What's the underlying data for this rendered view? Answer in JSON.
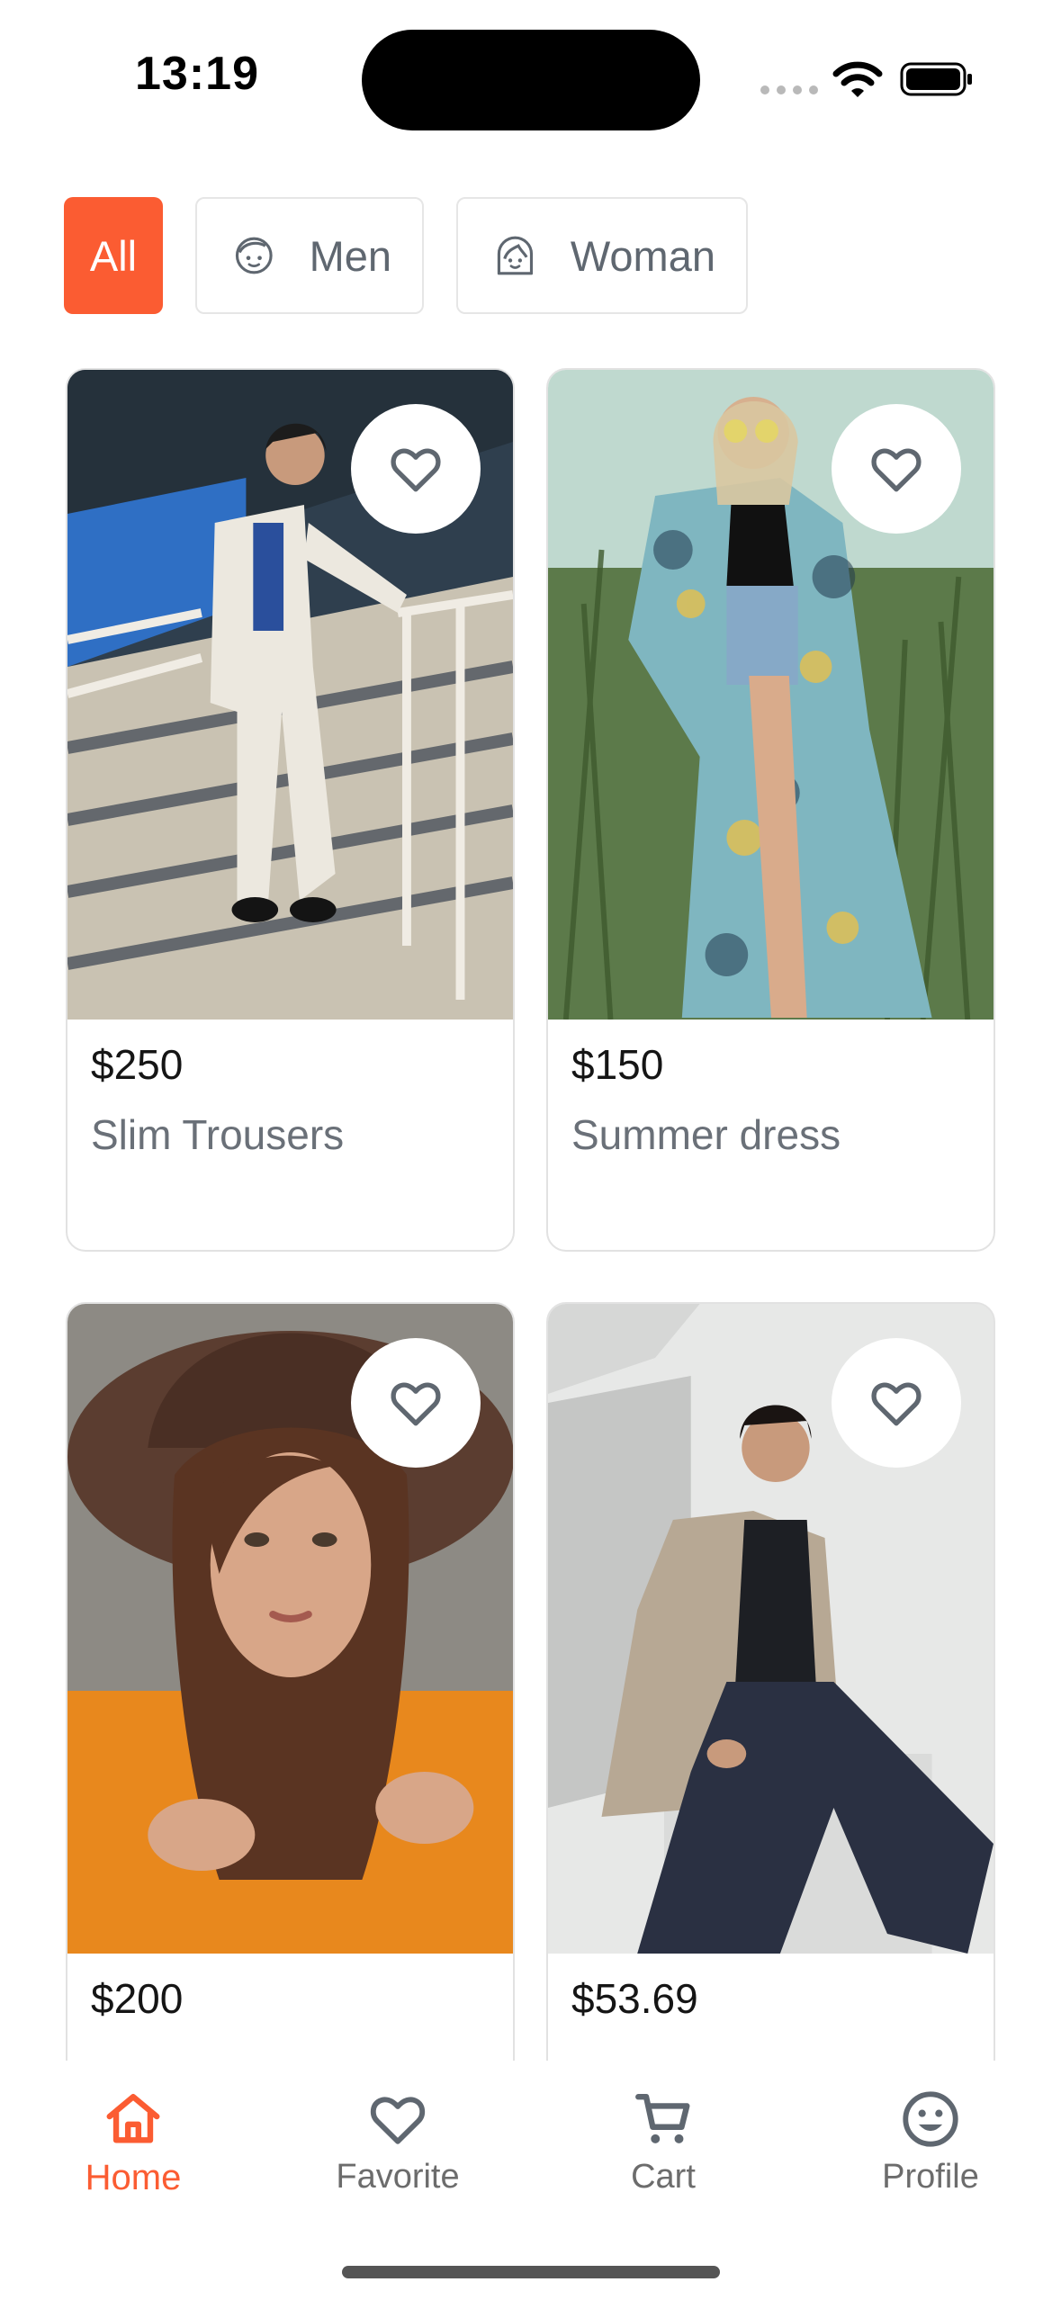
{
  "status": {
    "time": "13:19"
  },
  "filters": [
    {
      "label": "All",
      "icon": "none",
      "selected": true
    },
    {
      "label": "Men",
      "icon": "man-face-icon",
      "selected": false
    },
    {
      "label": "Woman",
      "icon": "woman-face-icon",
      "selected": false
    }
  ],
  "products": [
    {
      "price": "$250",
      "name": "Slim Trousers"
    },
    {
      "price": "$150",
      "name": "Summer dress"
    },
    {
      "price": "$200",
      "name": ""
    },
    {
      "price": "$53.69",
      "name": ""
    }
  ],
  "nav": {
    "home": "Home",
    "favorite": "Favorite",
    "cart": "Cart",
    "profile": "Profile"
  },
  "colors": {
    "accent": "#fb5c32",
    "muted_text": "#6a7078",
    "border": "#e2e2e2"
  }
}
